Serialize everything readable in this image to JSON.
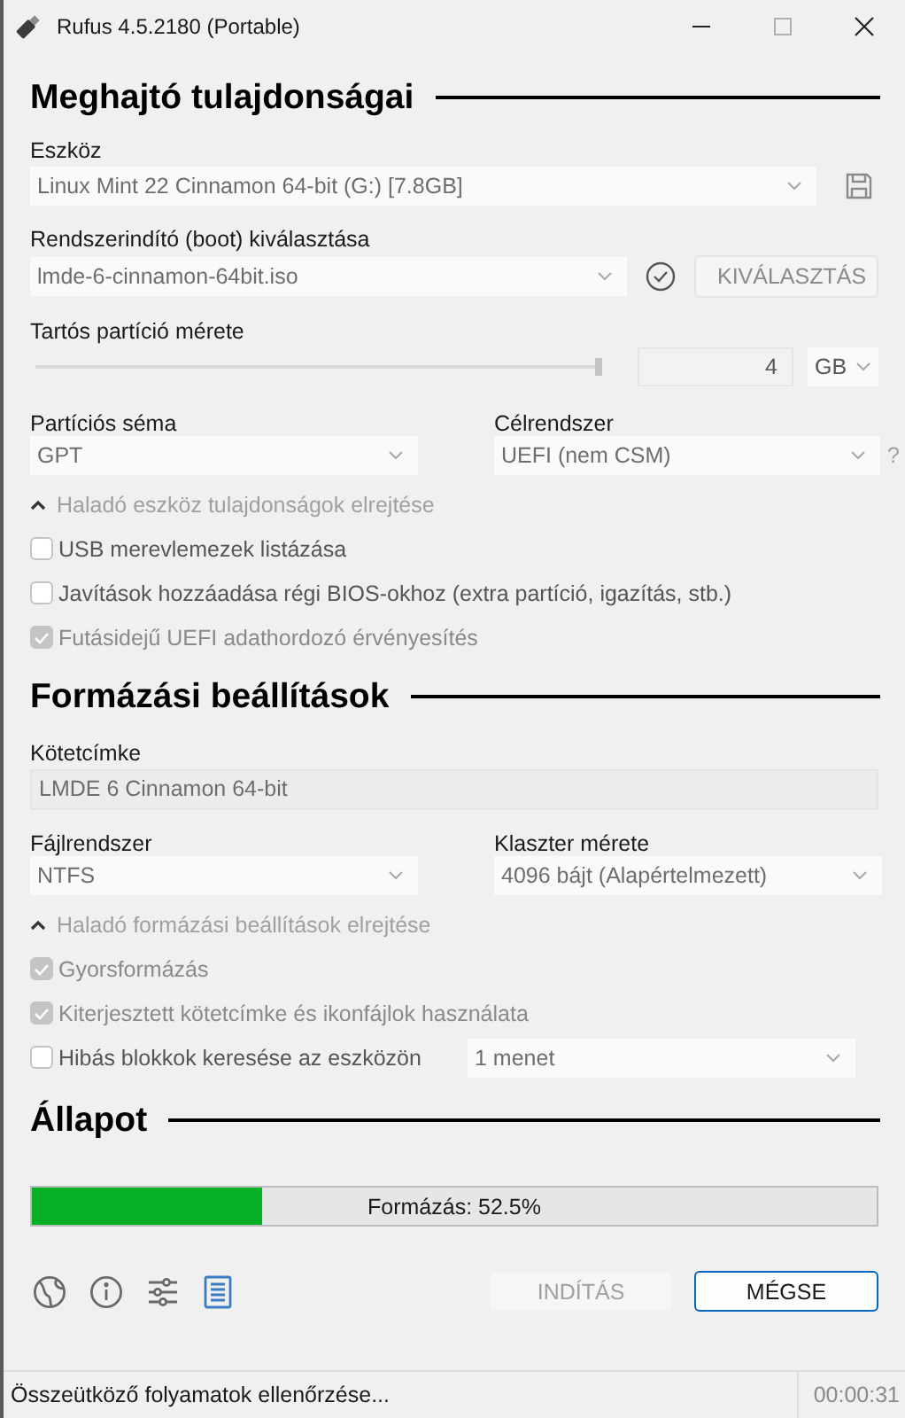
{
  "window": {
    "title": "Rufus 4.5.2180 (Portable)"
  },
  "drive_properties": {
    "heading": "Meghajtó tulajdonságai",
    "device": {
      "label": "Eszköz",
      "value": "Linux Mint 22 Cinnamon 64-bit (G:) [7.8GB]"
    },
    "boot_selection": {
      "label": "Rendszerindító (boot) kiválasztása",
      "value": "lmde-6-cinnamon-64bit.iso",
      "button": "KIVÁLASZTÁS"
    },
    "persistent_partition": {
      "label": "Tartós partíció mérete",
      "level": 1,
      "value": "4",
      "unit": "GB"
    },
    "partition_scheme": {
      "label": "Partíciós séma",
      "value": "GPT"
    },
    "target_system": {
      "label": "Célrendszer",
      "value": "UEFI (nem CSM)",
      "help": "?"
    },
    "advanced_toggle": "Haladó eszköz tulajdonságok elrejtése",
    "options": [
      {
        "label": "USB merevlemezek listázása",
        "checked": false,
        "disabled": false
      },
      {
        "label": "Javítások hozzáadása régi BIOS-okhoz (extra partíció, igazítás, stb.)",
        "checked": false,
        "disabled": false
      },
      {
        "label": "Futásidejű UEFI adathordozó érvényesítés",
        "checked": true,
        "disabled": true
      }
    ]
  },
  "format_options": {
    "heading": "Formázási beállítások",
    "volume_label": {
      "label": "Kötetcímke",
      "value": "LMDE 6 Cinnamon 64-bit"
    },
    "file_system": {
      "label": "Fájlrendszer",
      "value": "NTFS"
    },
    "cluster_size": {
      "label": "Klaszter mérete",
      "value": "4096 bájt (Alapértelmezett)"
    },
    "advanced_toggle": "Haladó formázási beállítások elrejtése",
    "options": [
      {
        "label": "Gyorsformázás",
        "checked": true,
        "disabled": true
      },
      {
        "label": "Kiterjesztett kötetcímke és ikonfájlok használata",
        "checked": true,
        "disabled": true
      },
      {
        "label": "Hibás blokkok keresése az eszközön",
        "checked": false,
        "disabled": false,
        "passes": "1 menet"
      }
    ]
  },
  "status": {
    "heading": "Állapot",
    "progress": {
      "level": 0.272,
      "text": "Formázás: 52.5%"
    }
  },
  "buttons": [
    {
      "label": "INDÍTÁS",
      "disabled": true
    },
    {
      "label": "MÉGSE",
      "disabled": false
    }
  ],
  "status_bar": {
    "text": "Összeütköző folyamatok ellenőrzése...",
    "time": "00:00:31"
  }
}
